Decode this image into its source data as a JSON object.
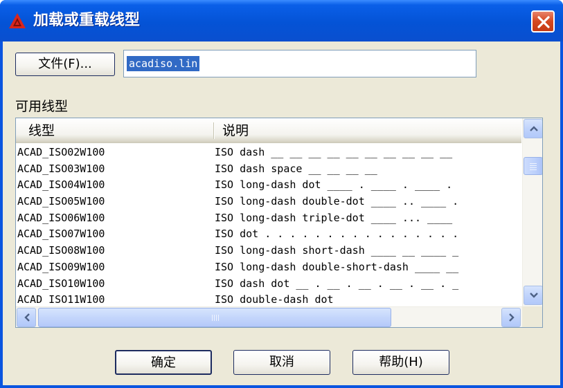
{
  "window": {
    "title": "加载或重载线型",
    "app_icon": "autocad-a-icon",
    "close_icon": "close-icon"
  },
  "file": {
    "button_label": "文件(F)...",
    "filename": "acadiso.lin"
  },
  "available_label": "可用线型",
  "list": {
    "columns": [
      "线型",
      "说明"
    ],
    "rows": [
      {
        "name": "ACAD_ISO02W100",
        "desc": "ISO dash __ __ __ __ __ __ __ __ __ __"
      },
      {
        "name": "ACAD_ISO03W100",
        "desc": "ISO dash space __    __    __    __"
      },
      {
        "name": "ACAD_ISO04W100",
        "desc": "ISO long-dash dot ____ . ____ . ____ ."
      },
      {
        "name": "ACAD_ISO05W100",
        "desc": "ISO long-dash double-dot ____ .. ____ ."
      },
      {
        "name": "ACAD_ISO06W100",
        "desc": "ISO long-dash triple-dot ____ ... ____"
      },
      {
        "name": "ACAD_ISO07W100",
        "desc": "ISO dot . . . . . . . . . . . . . . . ."
      },
      {
        "name": "ACAD_ISO08W100",
        "desc": "ISO long-dash short-dash ____ __ ____ _"
      },
      {
        "name": "ACAD_ISO09W100",
        "desc": "ISO long-dash double-short-dash ____ __"
      },
      {
        "name": "ACAD_ISO10W100",
        "desc": "ISO dash dot __ . __ . __ . __ . __ . _"
      },
      {
        "name": "ACAD_ISO11W100",
        "desc": "ISO double-dash dot"
      }
    ]
  },
  "buttons": {
    "ok": "确定",
    "cancel": "取消",
    "help": "帮助(H)"
  },
  "colors": {
    "titlebar": "#0453d6",
    "dialog_bg": "#ece9d8",
    "selection": "#316ac5",
    "close_button": "#d4471f",
    "app_icon": "#d9261c"
  }
}
